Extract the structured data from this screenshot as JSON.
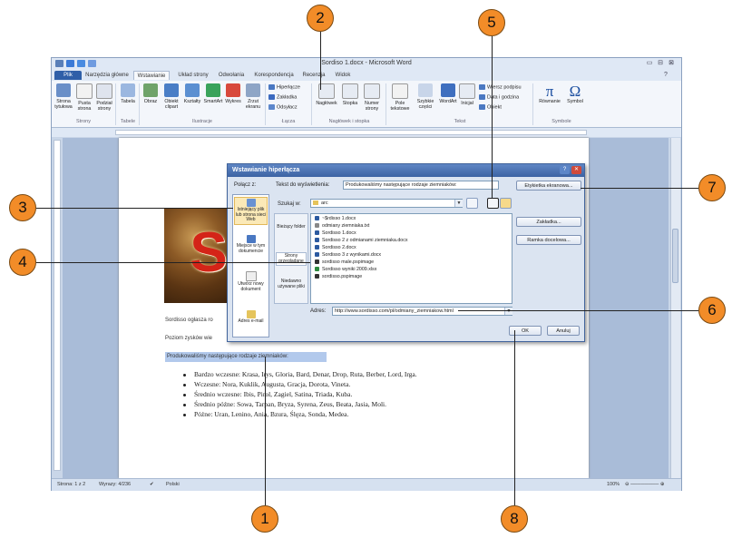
{
  "window": {
    "title": "Sordiso 1.docx - Microsoft Word",
    "min": "▭",
    "max": "⊟",
    "close": "⊠"
  },
  "tabs": [
    {
      "label": "Plik"
    },
    {
      "label": "Narzędzia główne"
    },
    {
      "label": "Wstawianie"
    },
    {
      "label": "Układ strony"
    },
    {
      "label": "Odwołania"
    },
    {
      "label": "Korespondencja"
    },
    {
      "label": "Recenzja"
    },
    {
      "label": "Widok"
    }
  ],
  "ribbon": {
    "groups": [
      "Strony",
      "Tabele",
      "Ilustracje",
      "Łącza",
      "Nagłówek i stopka",
      "Tekst",
      "Symbole"
    ],
    "buttons": {
      "strona_tytulowa": "Strona tytułowa",
      "pusta_strona": "Pusta strona",
      "podzial_strony": "Podział strony",
      "tabela": "Tabela",
      "obraz": "Obraz",
      "obiekt_clipart": "Obiekt clipart",
      "ksztalty": "Kształty",
      "smartart": "SmartArt",
      "wykres": "Wykres",
      "zrzut_ekranu": "Zrzut ekranu",
      "hiperlacze": "Hiperłącze",
      "zakladka": "Zakładka",
      "odsylacz": "Odsyłacz",
      "naglowek": "Nagłówek",
      "stopka": "Stopka",
      "numer_strony": "Numer strony",
      "pole_tekstowe": "Pole tekstowe",
      "szybkie_czesci": "Szybkie części",
      "wordart": "WordArt",
      "inicjal": "Inicjał",
      "wiersz_podpisu": "Wiersz podpisu",
      "data_i_godzina": "Data i godzina",
      "obiekt": "Obiekt",
      "rownanie": "Równanie",
      "symbol": "Symbol"
    }
  },
  "document": {
    "line1": "Sordisso ogłasza ro",
    "line2": "Poziom zysków wie",
    "selected": "Produkowaliśmy następujące rodzaje ziemniaków:",
    "bullets": [
      "Bardzo wczesne: Krasa, Irys, Gloria, Bard, Denar, Drop, Ruta, Berber, Lord, Irga.",
      "Wczesne: Nora, Kuklik, Augusta, Gracja, Dorota, Vineta.",
      "Średnio wczesne: Ibis, Pirol, Zagiel, Satina, Triada, Kuba.",
      "Średnio późne: Sowa, Tarpan, Bryza, Syrena, Zeus, Beata, Jasia, Moli.",
      "Późne: Uran, Lenino, Ania, Bzura, Ślęza, Sonda, Medea."
    ],
    "logo_letter": "S"
  },
  "dialog": {
    "title": "Wstawianie hiperłącza",
    "polacz_z": "Połącz z:",
    "tekst_label": "Tekst do wyświetlenia:",
    "tekst_value": "Produkowaliśmy następujące rodzaje ziemniaków:",
    "etykietka_button": "Etykietka ekranowa...",
    "szukaj_label": "Szukaj w:",
    "szukaj_value": "arc",
    "zakladka_button": "Zakładka...",
    "ramka_button": "Ramka docelowa...",
    "link_options": [
      "Istniejący plik lub strona sieci Web",
      "Miejsce w tym dokumencie",
      "Utwórz nowy dokument",
      "Adres e-mail"
    ],
    "sub_nav": [
      "Bieżący folder",
      "Strony przeglądane",
      "Niedawno używane pliki"
    ],
    "files": [
      "~$rdisso 1.docx",
      "odmiany ziemniaka.txt",
      "Sordisso 1.docx",
      "Sordisso 2 z odmianami ziemniaka.docx",
      "Sordisso 2.docx",
      "Sordisso 3 z wynikami.docx",
      "sordisso male.pspimage",
      "Sordisso wyniki 2009.xlsx",
      "sordisso.pspimage"
    ],
    "adres_label": "Adres:",
    "adres_value": "http://www.sordisso.com/pl/odmiany_ziemniakow.html",
    "ok_button": "OK",
    "anuluj_button": "Anuluj",
    "help": "?",
    "close": "✕"
  },
  "statusbar": {
    "page": "Strona: 1 z 2",
    "words": "Wyrazy: 4/236",
    "lang": "Polski",
    "zoom": "100%"
  },
  "callouts": [
    "1",
    "2",
    "3",
    "4",
    "5",
    "6",
    "7",
    "8"
  ]
}
